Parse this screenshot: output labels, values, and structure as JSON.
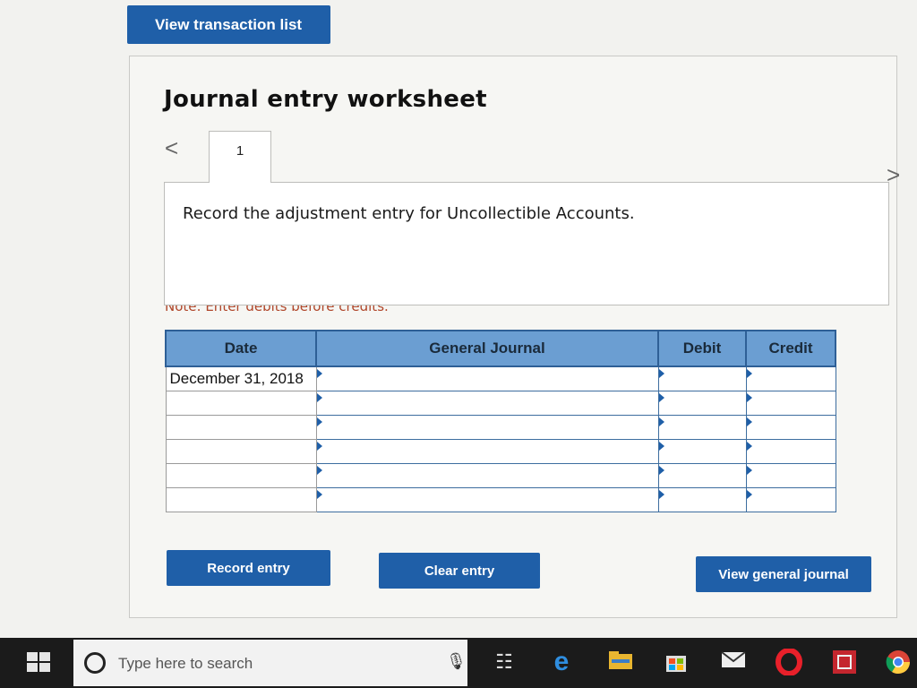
{
  "top_button": {
    "label": "View transaction list"
  },
  "worksheet": {
    "title": "Journal entry worksheet",
    "nav_prev": "<",
    "nav_next": ">",
    "active_tab": "1",
    "instruction": "Record the adjustment entry for Uncollectible Accounts.",
    "note": "Note: Enter debits before credits."
  },
  "table": {
    "columns": {
      "date": "Date",
      "journal": "General Journal",
      "debit": "Debit",
      "credit": "Credit"
    },
    "rows": [
      {
        "date": "December 31, 2018",
        "journal": "",
        "debit": "",
        "credit": ""
      },
      {
        "date": "",
        "journal": "",
        "debit": "",
        "credit": ""
      },
      {
        "date": "",
        "journal": "",
        "debit": "",
        "credit": ""
      },
      {
        "date": "",
        "journal": "",
        "debit": "",
        "credit": ""
      },
      {
        "date": "",
        "journal": "",
        "debit": "",
        "credit": ""
      },
      {
        "date": "",
        "journal": "",
        "debit": "",
        "credit": ""
      }
    ]
  },
  "buttons": {
    "record": "Record entry",
    "clear": "Clear entry",
    "view_journal": "View general journal"
  },
  "taskbar": {
    "search_placeholder": "Type here to search",
    "icons": [
      "windows-start-icon",
      "microphone-icon",
      "task-view-icon",
      "edge-browser-icon",
      "file-explorer-icon",
      "store-icon",
      "mail-icon",
      "opera-icon",
      "app-icon",
      "chrome-icon"
    ]
  },
  "colors": {
    "accent": "#1f5fa8",
    "header": "#6b9ed2",
    "note": "#b0462a"
  }
}
